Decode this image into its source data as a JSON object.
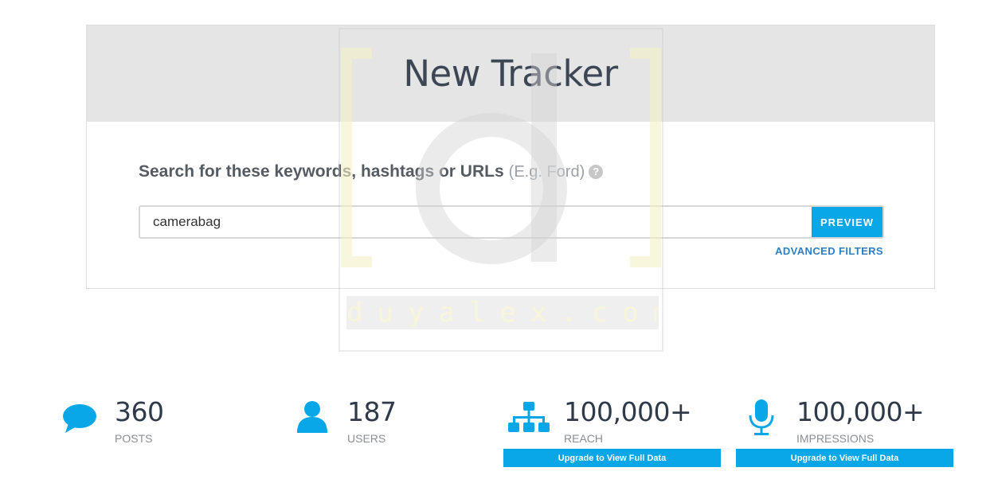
{
  "tracker": {
    "title": "New Tracker",
    "search_label": "Search for these keywords, hashtags or URLs",
    "search_hint": "(E.g. Ford)",
    "help_glyph": "?",
    "search_value": "camerabag",
    "preview_label": "PREVIEW",
    "advanced_filters_label": "ADVANCED FILTERS"
  },
  "watermark": {
    "text": "duyalex.com"
  },
  "stats": [
    {
      "icon": "speech-bubble-icon",
      "value": "360",
      "label": "POSTS"
    },
    {
      "icon": "user-icon",
      "value": "187",
      "label": "USERS"
    },
    {
      "icon": "network-icon",
      "value": "100,000+",
      "label": "REACH",
      "upgrade_label": "Upgrade to View Full Data"
    },
    {
      "icon": "microphone-icon",
      "value": "100,000+",
      "label": "IMPRESSIONS",
      "upgrade_label": "Upgrade to View Full Data"
    }
  ],
  "colors": {
    "accent": "#0aa7e8",
    "header_bg": "#e5e5e5",
    "link": "#2f7fc0",
    "stat_value": "#2e3a4a"
  }
}
